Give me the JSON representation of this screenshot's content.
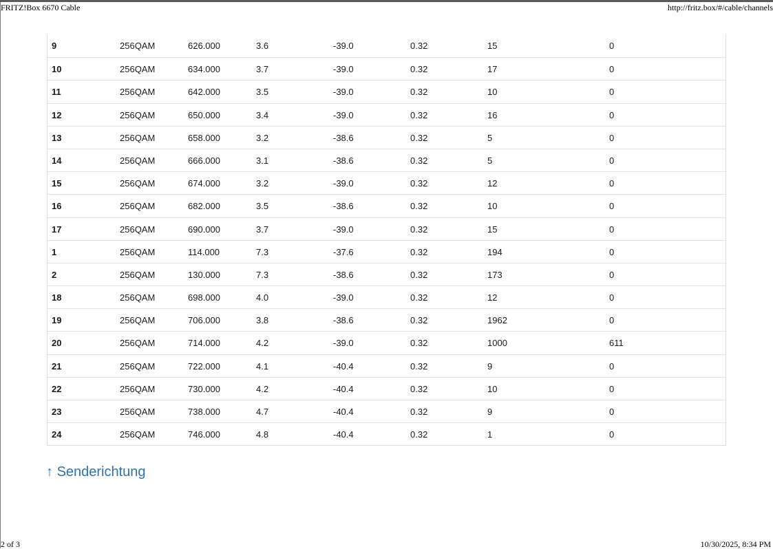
{
  "print_header": {
    "title": "FRITZ!Box 6670 Cable",
    "url": "http://fritz.box/#/cable/channels"
  },
  "print_footer": {
    "page": "2 of 3",
    "datetime": "10/30/2025, 8:34 PM"
  },
  "channel_table": {
    "rows": [
      [
        "9",
        "256QAM",
        "626.000",
        "3.6",
        "-39.0",
        "0.32",
        "15",
        "0"
      ],
      [
        "10",
        "256QAM",
        "634.000",
        "3.7",
        "-39.0",
        "0.32",
        "17",
        "0"
      ],
      [
        "11",
        "256QAM",
        "642.000",
        "3.5",
        "-39.0",
        "0.32",
        "10",
        "0"
      ],
      [
        "12",
        "256QAM",
        "650.000",
        "3.4",
        "-39.0",
        "0.32",
        "16",
        "0"
      ],
      [
        "13",
        "256QAM",
        "658.000",
        "3.2",
        "-38.6",
        "0.32",
        "5",
        "0"
      ],
      [
        "14",
        "256QAM",
        "666.000",
        "3.1",
        "-38.6",
        "0.32",
        "5",
        "0"
      ],
      [
        "15",
        "256QAM",
        "674.000",
        "3.2",
        "-39.0",
        "0.32",
        "12",
        "0"
      ],
      [
        "16",
        "256QAM",
        "682.000",
        "3.5",
        "-38.6",
        "0.32",
        "10",
        "0"
      ],
      [
        "17",
        "256QAM",
        "690.000",
        "3.7",
        "-39.0",
        "0.32",
        "15",
        "0"
      ],
      [
        "1",
        "256QAM",
        "114.000",
        "7.3",
        "-37.6",
        "0.32",
        "194",
        "0"
      ],
      [
        "2",
        "256QAM",
        "130.000",
        "7.3",
        "-38.6",
        "0.32",
        "173",
        "0"
      ],
      [
        "18",
        "256QAM",
        "698.000",
        "4.0",
        "-39.0",
        "0.32",
        "12",
        "0"
      ],
      [
        "19",
        "256QAM",
        "706.000",
        "3.8",
        "-38.6",
        "0.32",
        "1962",
        "0"
      ],
      [
        "20",
        "256QAM",
        "714.000",
        "4.2",
        "-39.0",
        "0.32",
        "1000",
        "611"
      ],
      [
        "21",
        "256QAM",
        "722.000",
        "4.1",
        "-40.4",
        "0.32",
        "9",
        "0"
      ],
      [
        "22",
        "256QAM",
        "730.000",
        "4.2",
        "-40.4",
        "0.32",
        "10",
        "0"
      ],
      [
        "23",
        "256QAM",
        "738.000",
        "4.7",
        "-40.4",
        "0.32",
        "9",
        "0"
      ],
      [
        "24",
        "256QAM",
        "746.000",
        "4.8",
        "-40.4",
        "0.32",
        "1",
        "0"
      ]
    ]
  },
  "section_link": {
    "arrow": "↑",
    "label": "Senderichtung"
  },
  "colors": {
    "link": "#2f73a8",
    "row_border": "#e2e2e2"
  }
}
